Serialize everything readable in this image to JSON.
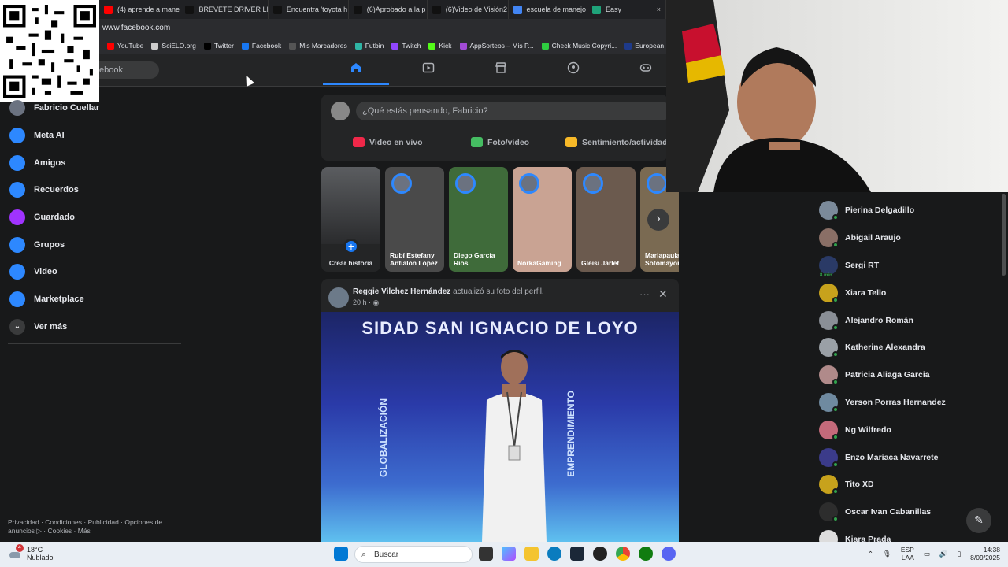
{
  "browser": {
    "tabs": [
      {
        "label": "(4) aprende a mane",
        "color": "#ff0000"
      },
      {
        "label": "BREVETE DRIVER LI",
        "color": "#111111"
      },
      {
        "label": "Encuentra 'toyota h",
        "color": "#111111"
      },
      {
        "label": "(6)Aprobado a la p",
        "color": "#111111"
      },
      {
        "label": "(6)Video de Visión2",
        "color": "#111111"
      },
      {
        "label": "escuela de manejo",
        "color": "#4285f4"
      },
      {
        "label": "Easy",
        "color": "#1fa37a"
      }
    ],
    "tab_close": "×",
    "address": "www.facebook.com",
    "bookmarks": [
      {
        "label": "YouTube",
        "color": "#ff0000"
      },
      {
        "label": "SciELO.org",
        "color": "#cccccc"
      },
      {
        "label": "Twitter",
        "color": "#000000"
      },
      {
        "label": "Facebook",
        "color": "#1877f2"
      },
      {
        "label": "Mis Marcadores",
        "color": "#555555"
      },
      {
        "label": "Futbin",
        "color": "#2fb5a5"
      },
      {
        "label": "Twitch",
        "color": "#9146ff"
      },
      {
        "label": "Kick",
        "color": "#53fc18"
      },
      {
        "label": "AppSorteos – Mis P...",
        "color": "#a24bd6"
      },
      {
        "label": "Check Music Copyri...",
        "color": "#2ecc40"
      },
      {
        "label": "European E",
        "color": "#1e3a8a"
      }
    ]
  },
  "header": {
    "search_text": "ebook"
  },
  "sidebar": {
    "items": [
      {
        "label": "Fabricio Cuellar",
        "icon": "profile-avatar",
        "color": "#6b7280"
      },
      {
        "label": "Meta AI",
        "icon": "meta-ai-icon",
        "color": "#2d88ff"
      },
      {
        "label": "Amigos",
        "icon": "friends-icon",
        "color": "#2d88ff"
      },
      {
        "label": "Recuerdos",
        "icon": "memories-icon",
        "color": "#2d88ff"
      },
      {
        "label": "Guardado",
        "icon": "saved-icon",
        "color": "#a033ff"
      },
      {
        "label": "Grupos",
        "icon": "groups-icon",
        "color": "#2d88ff"
      },
      {
        "label": "Video",
        "icon": "video-icon",
        "color": "#2d88ff"
      },
      {
        "label": "Marketplace",
        "icon": "marketplace-icon",
        "color": "#2d88ff"
      },
      {
        "label": "Ver más",
        "icon": "chevron-down-icon",
        "color": "#3a3b3c"
      }
    ],
    "footer": "Privacidad · Condiciones · Publicidad · Opciones de anuncios ▷ · Cookies · Más"
  },
  "composer": {
    "placeholder": "¿Qué estás pensando, Fabricio?",
    "actions": [
      {
        "label": "Video en vivo",
        "color": "#f02849"
      },
      {
        "label": "Foto/video",
        "color": "#45bd62"
      },
      {
        "label": "Sentimiento/actividad",
        "color": "#f7b928"
      }
    ]
  },
  "stories": {
    "create_label": "Crear historia",
    "items": [
      {
        "name": "Rubí Estefany Antialón López",
        "bg": "#4a4a4a"
      },
      {
        "name": "Diego García Ríos",
        "bg": "#3f6b3a"
      },
      {
        "name": "NorkaGaming",
        "bg": "#c9a393"
      },
      {
        "name": "Gleisi Jarlet",
        "bg": "#6b5a4e"
      },
      {
        "name": "Mariapaula Sotomayor",
        "bg": "#7a6a52"
      }
    ]
  },
  "post": {
    "author": "Reggie Vilchez Hernández",
    "action": "actualizó su foto del perfil.",
    "time": "20 h · ◉",
    "more": "···",
    "close": "✕",
    "banner": "SIDAD SAN IGNACIO DE LOYO",
    "left_word": "GLOBALIZACIÓN",
    "right_word": "EMPRENDIMIENTO"
  },
  "contacts": [
    {
      "name": "Pierina Delgadillo",
      "online": true,
      "color": "#7b8a9a"
    },
    {
      "name": "Abigail Araujo",
      "online": true,
      "color": "#8a6f66"
    },
    {
      "name": "Sergi RT",
      "online": false,
      "badge": "8 min",
      "color": "#2a3a66"
    },
    {
      "name": "Xiara Tello",
      "online": true,
      "color": "#c7a21c"
    },
    {
      "name": "Alejandro Román",
      "online": true,
      "color": "#8a8f96"
    },
    {
      "name": "Katherine Alexandra",
      "online": true,
      "color": "#9aa0a6"
    },
    {
      "name": "Patricia Aliaga Garcia",
      "online": true,
      "color": "#b08a8a"
    },
    {
      "name": "Yerson Porras Hernandez",
      "online": true,
      "color": "#6f8aa0"
    },
    {
      "name": "Ng Wilfredo",
      "online": true,
      "color": "#c46a7a"
    },
    {
      "name": "Enzo Mariaca Navarrete",
      "online": true,
      "color": "#3b3b8a"
    },
    {
      "name": "Tito XD",
      "online": true,
      "color": "#c7a21c"
    },
    {
      "name": "Oscar Ivan Cabanillas",
      "online": true,
      "color": "#2d2d2d"
    },
    {
      "name": "Kiara Prada",
      "online": false,
      "color": "#dddddd"
    }
  ],
  "taskbar": {
    "weather_badge": "4",
    "weather_temp": "18°C",
    "weather_desc": "Nublado",
    "search": "Buscar",
    "lang_top": "ESP",
    "lang_bottom": "LAA",
    "time": "14:38",
    "date": "8/09/2025"
  }
}
